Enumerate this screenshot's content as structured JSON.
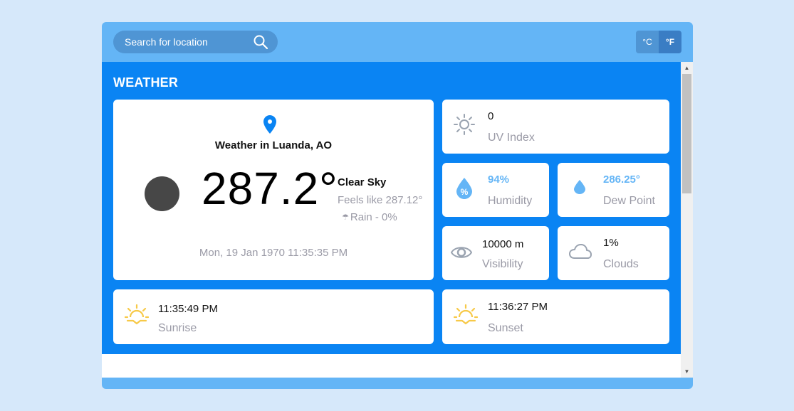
{
  "search": {
    "placeholder": "Search for location"
  },
  "units": {
    "celsius": "°C",
    "fahrenheit": "°F",
    "selected": "fahrenheit"
  },
  "section_title": "WEATHER",
  "current": {
    "location": "Weather in Luanda, AO",
    "temperature": "287.2°",
    "condition": "Clear Sky",
    "feels_like": "Feels like 287.12°",
    "rain": "Rain - 0%",
    "datetime": "Mon, 19 Jan 1970 11:35:35 PM"
  },
  "uv": {
    "value": "0",
    "label": "UV Index"
  },
  "humidity": {
    "value": "94%",
    "label": "Humidity"
  },
  "dew_point": {
    "value": "286.25°",
    "label": "Dew Point"
  },
  "visibility": {
    "value": "10000 m",
    "label": "Visibility"
  },
  "clouds": {
    "value": "1%",
    "label": "Clouds"
  },
  "sunrise": {
    "value": "11:35:49 PM",
    "label": "Sunrise"
  },
  "sunset": {
    "value": "11:36:27 PM",
    "label": "Sunset"
  },
  "colors": {
    "page_bg": "#d6e8fa",
    "header": "#64b5f6",
    "panel": "#0a84f3",
    "accent_blue": "#64b5f6",
    "sun_yellow": "#f7c948",
    "muted_text": "#9a9aa6"
  }
}
